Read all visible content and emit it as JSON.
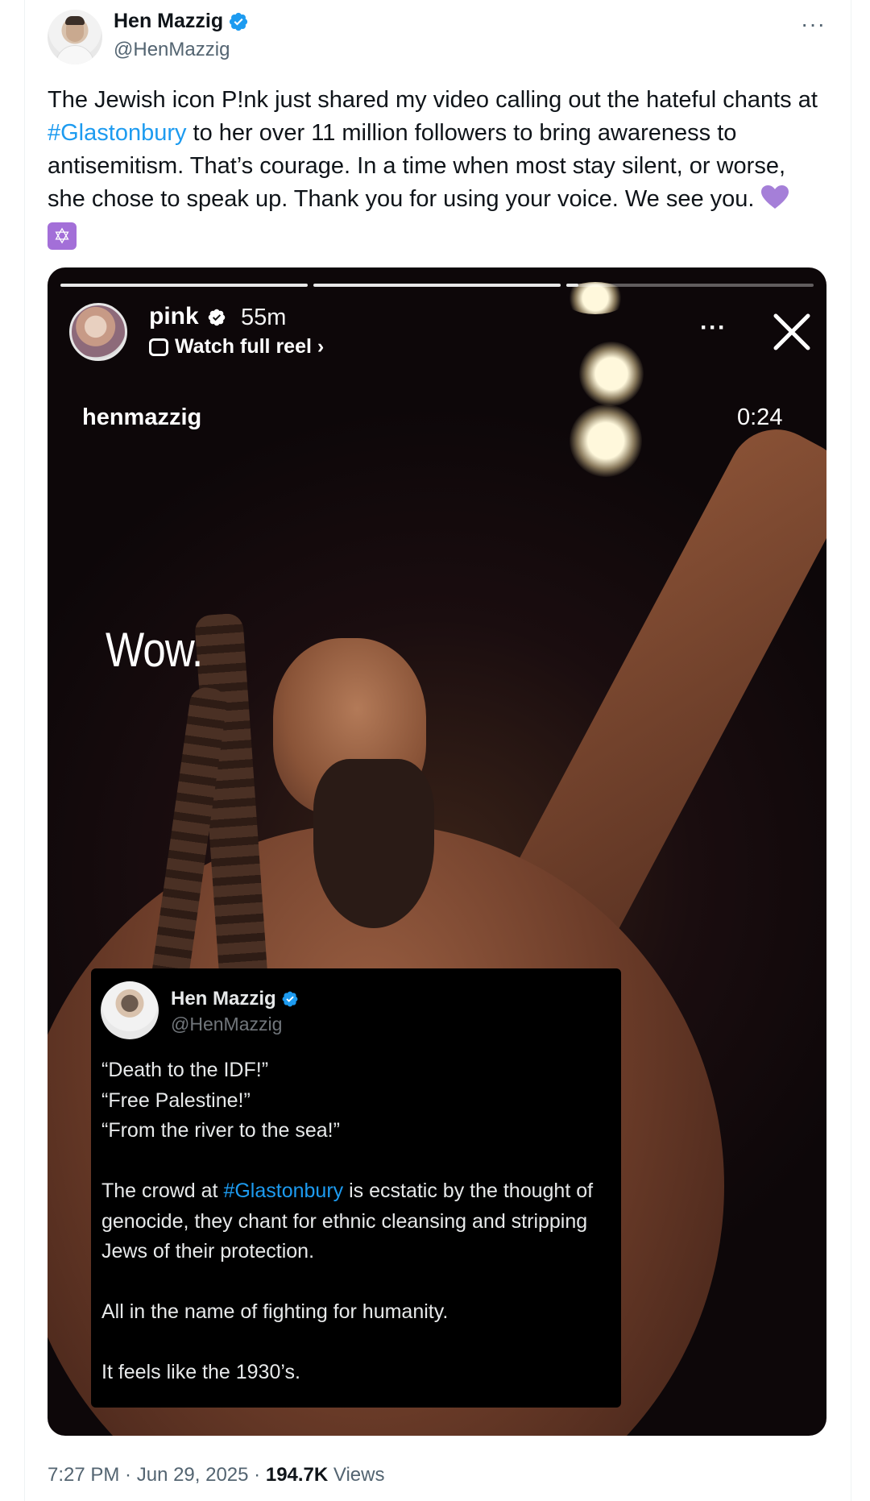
{
  "author": {
    "display_name": "Hen Mazzig",
    "handle": "@HenMazzig"
  },
  "more_label": "···",
  "tweet": {
    "text_before_tag": "The Jewish icon P!nk just shared my video calling out the hateful chants at ",
    "hashtag": "#Glastonbury",
    "text_after_tag": " to her over 11 million followers to bring awareness to antisemitism. That’s courage. In a time when most stay silent, or worse, she chose to speak up. Thank you for using your voice. We see you. ",
    "star_glyph": "✡"
  },
  "media": {
    "story_user": "pink",
    "story_age": "55m",
    "watch_full": "Watch full reel ›",
    "more_label": "···",
    "overlay_user": "henmazzig",
    "overlay_clock": "0:24",
    "caption": "Wow.",
    "progress_segments": [
      1,
      1,
      0.05
    ],
    "embedded_post": {
      "display_name": "Hen Mazzig",
      "handle": "@HenMazzig",
      "lines": [
        "“Death to the IDF!”",
        "“Free Palestine!”",
        "“From the river to the sea!”"
      ],
      "para_before_tag": "The crowd at ",
      "hashtag": "#Glastonbury",
      "para_after_tag": " is ecstatic by the thought of genocide, they chant for ethnic cleansing and stripping Jews of their protection.",
      "para2": "All in the name of fighting for humanity.",
      "para3": "It feels like the 1930’s."
    }
  },
  "meta": {
    "time": "7:27 PM",
    "sep1": " · ",
    "date": "Jun 29, 2025",
    "sep2": " · ",
    "views_count": "194.7K",
    "views_label": " Views"
  },
  "colors": {
    "link": "#1d9bf0",
    "verified": "#1d9bf0",
    "heart": "#a57fd8",
    "muted": "#536471"
  },
  "icons": [
    "verified-badge-icon",
    "more-icon",
    "purple-heart-icon",
    "star-of-david-icon",
    "reel-icon",
    "close-icon"
  ]
}
